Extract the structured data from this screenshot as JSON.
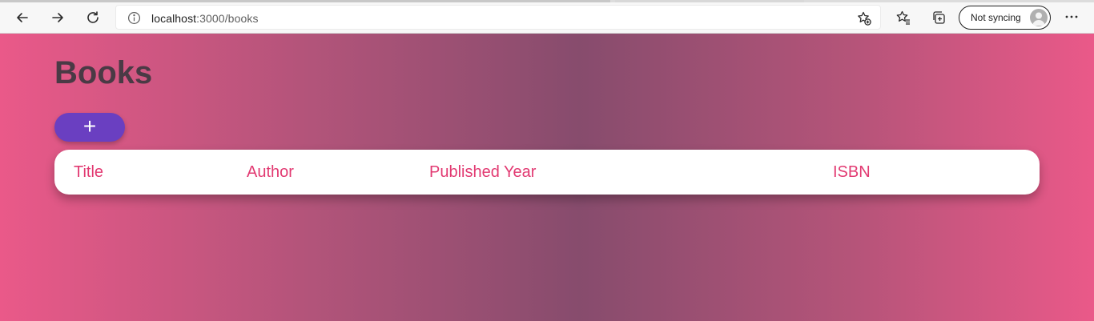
{
  "browser": {
    "url_host": "localhost",
    "url_path": ":3000/books",
    "profile_label": "Not syncing",
    "icons": {
      "back": "arrow-left-icon",
      "forward": "arrow-right-icon",
      "refresh": "refresh-icon",
      "info": "info-icon",
      "add_favorite": "star-plus-icon",
      "favorites": "favorites-icon",
      "collections": "collections-icon",
      "more": "more-horizontal-icon"
    }
  },
  "page": {
    "title": "Books",
    "add_label": "+",
    "table": {
      "columns": [
        "Title",
        "Author",
        "Published Year",
        "ISBN"
      ]
    },
    "colors": {
      "title": "#4a3a45",
      "add_button": "#6a3fc1",
      "header_text": "#e23a72",
      "gradient_edge": "#ea5989",
      "gradient_center": "#874c6d"
    }
  }
}
